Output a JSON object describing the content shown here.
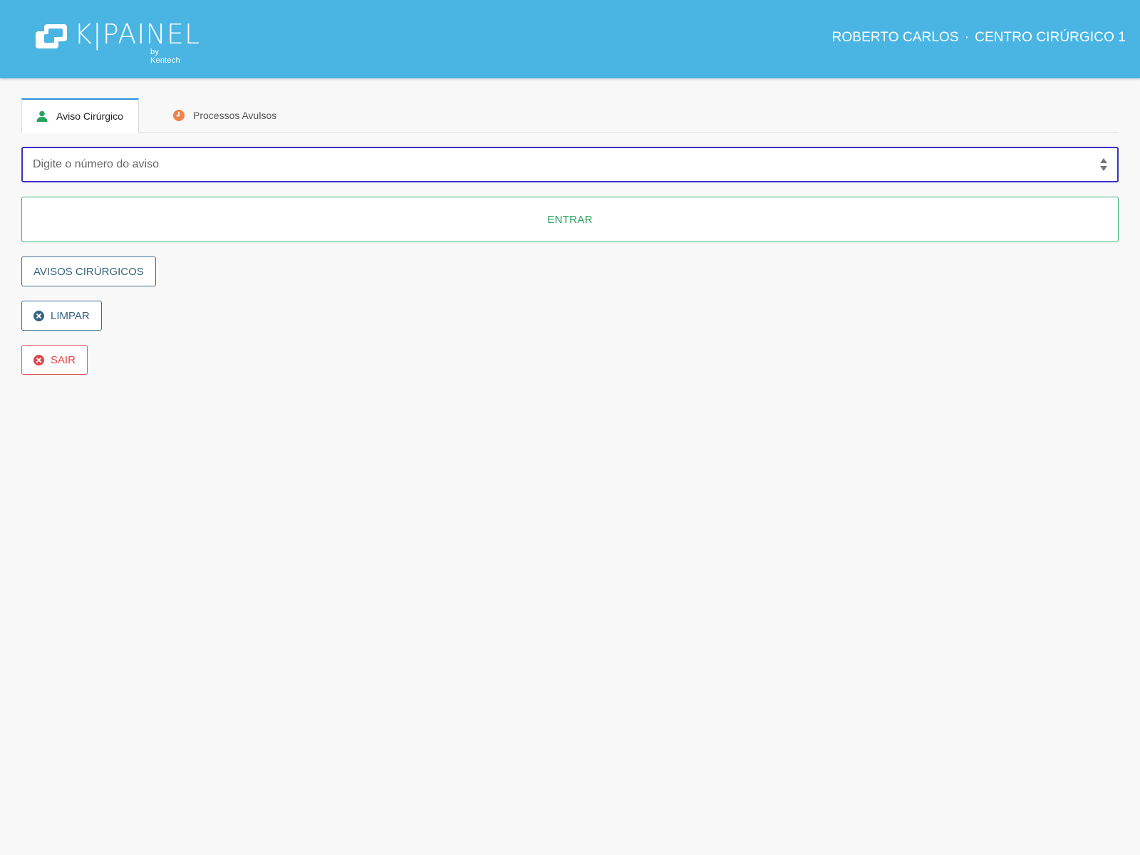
{
  "header": {
    "logo_text": "K|PAINEL",
    "logo_byline": "by Kentech",
    "user_name": "ROBERTO CARLOS",
    "separator": "·",
    "location": "CENTRO CIRÚRGICO 1"
  },
  "tabs": [
    {
      "label": "Aviso Cirúrgico",
      "icon": "user-icon",
      "active": true
    },
    {
      "label": "Processos Avulsos",
      "icon": "clock-icon",
      "active": false
    }
  ],
  "aviso_input": {
    "placeholder": "Digite o número do aviso",
    "value": ""
  },
  "buttons": {
    "entrar": "ENTRAR",
    "avisos": "AVISOS CIRÚRGICOS",
    "limpar": "LIMPAR",
    "sair": "SAIR"
  },
  "colors": {
    "header_bg": "#4ab5e3",
    "page_bg": "#f8f8f8",
    "input_border": "#3b2fc9",
    "entrar": "#27a462",
    "outline": "#37617f",
    "sair": "#e0474c",
    "tab_active_border": "#2b8fe0"
  }
}
